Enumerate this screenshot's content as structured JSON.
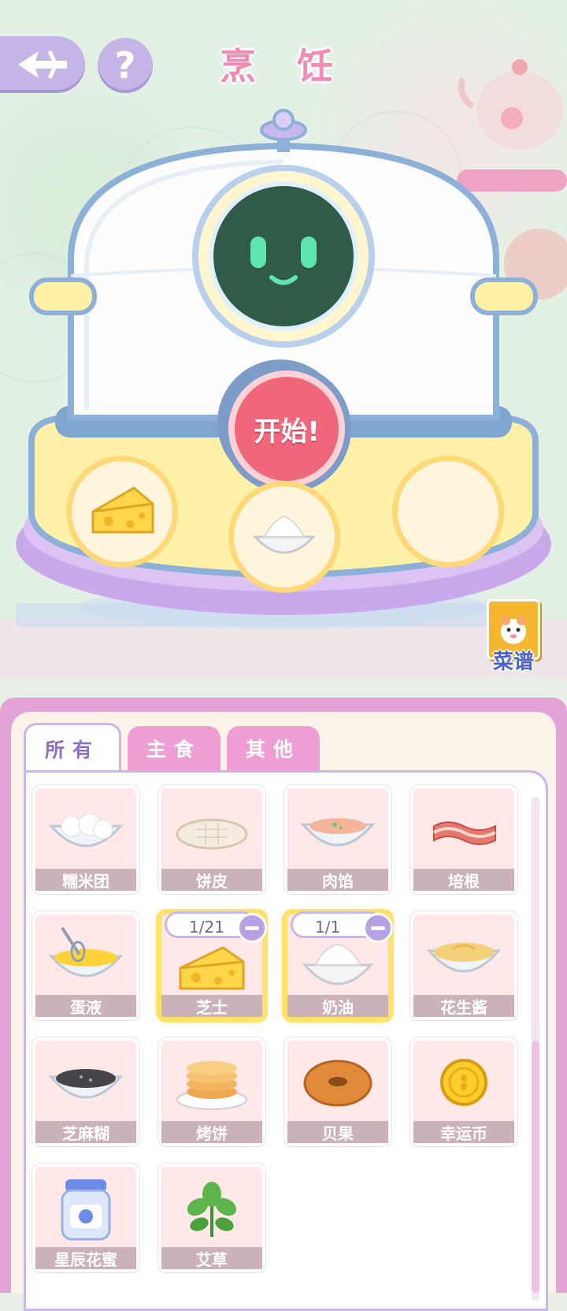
{
  "header": {
    "title": "烹 饪",
    "help_label": "?"
  },
  "machine": {
    "start_label": "开始!",
    "slots": [
      {
        "ingredient": "cheese-icon"
      },
      {
        "ingredient": "cream-icon"
      },
      {
        "ingredient": ""
      }
    ]
  },
  "recipe": {
    "label": "菜谱"
  },
  "tabs": [
    {
      "label": "所有",
      "active": true
    },
    {
      "label": "主食",
      "active": false
    },
    {
      "label": "其他",
      "active": false
    }
  ],
  "items": [
    {
      "name": "糯米团",
      "icon": "rice-ball-icon"
    },
    {
      "name": "饼皮",
      "icon": "dough-icon"
    },
    {
      "name": "肉馅",
      "icon": "meat-filling-icon"
    },
    {
      "name": "培根",
      "icon": "bacon-icon"
    },
    {
      "name": "蛋液",
      "icon": "egg-liquid-icon"
    },
    {
      "name": "芝士",
      "icon": "cheese-icon",
      "selected": true,
      "count": "1/21"
    },
    {
      "name": "奶油",
      "icon": "cream-icon",
      "selected": true,
      "count": "1/1"
    },
    {
      "name": "花生酱",
      "icon": "peanut-butter-icon"
    },
    {
      "name": "芝麻糊",
      "icon": "sesame-paste-icon"
    },
    {
      "name": "烤饼",
      "icon": "pancake-icon"
    },
    {
      "name": "贝果",
      "icon": "bagel-icon"
    },
    {
      "name": "幸运币",
      "icon": "lucky-coin-icon"
    },
    {
      "name": "星辰花蜜",
      "icon": "honey-jar-icon"
    },
    {
      "name": "艾草",
      "icon": "herb-icon"
    }
  ],
  "colors": {
    "title_pink": "#ee8cb4",
    "start_red": "#f0677c",
    "tab_pink": "#ef9ed3",
    "panel_purple": "#e3a3d6",
    "selected_gold": "#ffe26a"
  }
}
